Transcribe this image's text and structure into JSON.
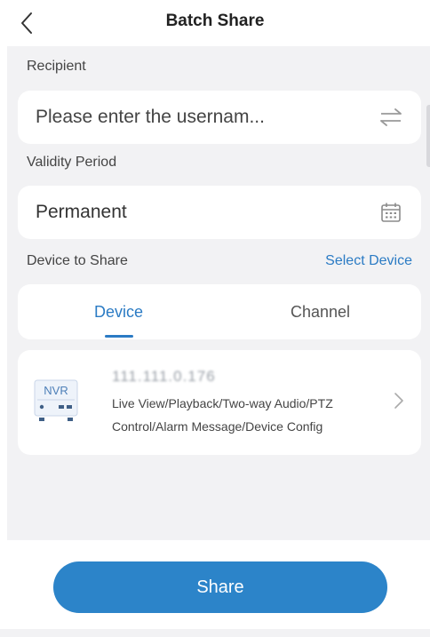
{
  "header": {
    "title": "Batch Share",
    "back_icon": "chevron-left-icon"
  },
  "recipient": {
    "label": "Recipient",
    "placeholder": "Please enter the usernam...",
    "icon": "swap-arrows-icon"
  },
  "validity": {
    "label": "Validity Period",
    "value": "Permanent",
    "icon": "calendar-icon"
  },
  "device_to_share": {
    "label": "Device to Share",
    "select_link": "Select Device"
  },
  "tabs": [
    {
      "label": "Device",
      "active": true
    },
    {
      "label": "Channel",
      "active": false
    }
  ],
  "device": {
    "type_badge": "NVR",
    "name": "111.111.0.176",
    "permissions": "Live View/Playback/Two-way Audio/PTZ Control/Alarm Message/Device Config",
    "chevron_icon": "chevron-right-icon"
  },
  "share_button": {
    "label": "Share"
  },
  "colors": {
    "accent": "#2b7bc4",
    "button": "#2c84c9",
    "background": "#f2f2f4"
  }
}
